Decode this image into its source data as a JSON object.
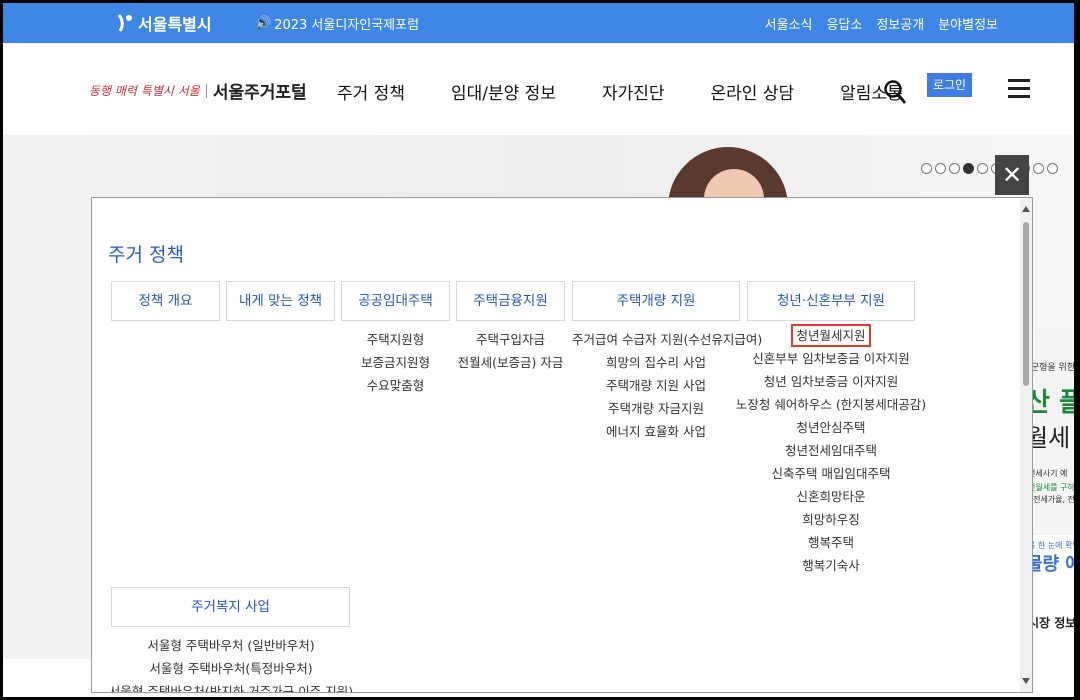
{
  "topbar": {
    "logo_text": "서울특별시",
    "news_icon": "speaker-icon",
    "news_text": "2023 서울디자인국제포럼",
    "links": [
      "서울소식",
      "응답소",
      "정보공개",
      "분야별정보"
    ]
  },
  "header": {
    "slogan": "동행 매력 특별시 서울",
    "site_name": "서울주거포털",
    "nav": [
      "주거 정책",
      "임대/분양 정보",
      "자가진단",
      "온라인 상담",
      "알림소통"
    ],
    "login_label": "로그인"
  },
  "hero": {
    "close_label": "✕",
    "banner": {
      "line1": "·군형을 위한",
      "line2": "산 플",
      "line3": "월세 시",
      "line4": "전세사기 예",
      "line5": "전월세를 구하",
      "line6": ", 전세가율, 전",
      "line7": "",
      "line8": "를 한 눈에 확인",
      "line9": "물량 예",
      "line10": "시장 정보"
    }
  },
  "panel": {
    "title": "주거 정책",
    "categories": [
      {
        "label": "정책 개요",
        "items": []
      },
      {
        "label": "내게 맞는 정책",
        "items": []
      },
      {
        "label": "공공임대주택",
        "items": [
          "주택지원형",
          "보증금지원형",
          "수요맞춤형"
        ]
      },
      {
        "label": "주택금융지원",
        "items": [
          "주택구입자금",
          "전월세(보증금) 자금"
        ]
      },
      {
        "label": "주택개량 지원",
        "items": [
          "주거급여 수급자 지원(수선유지급여)",
          "희망의 집수리 사업",
          "주택개량 지원 사업",
          "주택개량 자금지원",
          "에너지 효율화 사업"
        ]
      },
      {
        "label": "청년·신혼부부 지원",
        "items": [
          "청년월세지원",
          "신혼부부 임차보증금 이자지원",
          "청년 임차보증금 이자지원",
          "노장청 쉐어하우스 (한지붕세대공감)",
          "청년안심주택",
          "청년전세임대주택",
          "신축주택 매입임대주택",
          "신혼희망타운",
          "희망하우징",
          "행복주택",
          "행복기숙사"
        ]
      }
    ],
    "welfare": {
      "label": "주거복지 사업",
      "items": [
        "서울형 주택바우처 (일반바우처)",
        "서울형 주택바우처(특정바우처)",
        "서울형 주택바우처(반지하 거주가구 이주 지원)"
      ]
    }
  }
}
